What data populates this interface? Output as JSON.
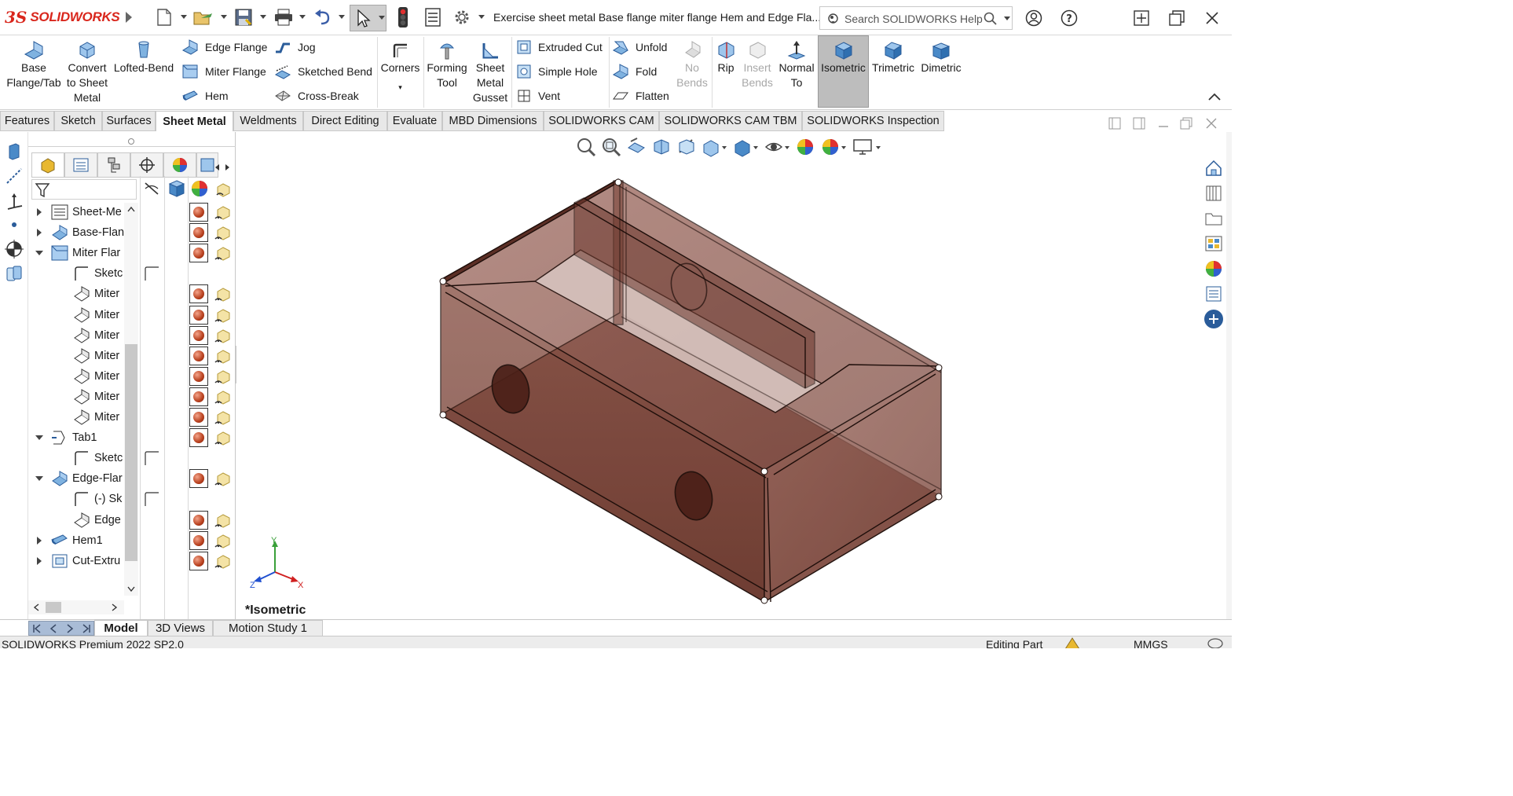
{
  "app": {
    "logo_ds": "3S",
    "logo_text": "SOLIDWORKS",
    "document_title": "Exercise sheet metal Base flange miter flange Hem and Edge Fla...",
    "brand_color": "#d9261c"
  },
  "search": {
    "placeholder": "Search SOLIDWORKS Help"
  },
  "ribbon": {
    "base_flange_l1": "Base",
    "base_flange_l2": "Flange/Tab",
    "convert_l1": "Convert",
    "convert_l2": "to Sheet",
    "convert_l3": "Metal",
    "lofted_bend": "Lofted-Bend",
    "edge_flange": "Edge Flange",
    "miter_flange": "Miter Flange",
    "hem": "Hem",
    "jog": "Jog",
    "sketched_bend": "Sketched Bend",
    "cross_break": "Cross-Break",
    "corners": "Corners",
    "forming_l1": "Forming",
    "forming_l2": "Tool",
    "gusset_l1": "Sheet",
    "gusset_l2": "Metal",
    "gusset_l3": "Gusset",
    "extruded_cut": "Extruded Cut",
    "simple_hole": "Simple Hole",
    "vent": "Vent",
    "unfold": "Unfold",
    "fold": "Fold",
    "flatten": "Flatten",
    "no_bends_l1": "No",
    "no_bends_l2": "Bends",
    "rip": "Rip",
    "insert_bends_l1": "Insert",
    "insert_bends_l2": "Bends",
    "normal_l1": "Normal",
    "normal_l2": "To",
    "isometric": "Isometric",
    "trimetric": "Trimetric",
    "dimetric": "Dimetric"
  },
  "tabs": [
    "Features",
    "Sketch",
    "Surfaces",
    "Sheet Metal",
    "Weldments",
    "Direct Editing",
    "Evaluate",
    "MBD Dimensions",
    "SOLIDWORKS CAM",
    "SOLIDWORKS CAM TBM",
    "SOLIDWORKS Inspection"
  ],
  "active_tab": "Sheet Metal",
  "tree": [
    {
      "label": "Sheet-Me",
      "expand": "collapsed",
      "indent": 0
    },
    {
      "label": "Base-Flan",
      "expand": "collapsed",
      "indent": 0
    },
    {
      "label": "Miter Flar",
      "expand": "expanded",
      "indent": 0
    },
    {
      "label": "Sketc",
      "expand": "none",
      "indent": 1
    },
    {
      "label": "Miter",
      "expand": "none",
      "indent": 1
    },
    {
      "label": "Miter",
      "expand": "none",
      "indent": 1
    },
    {
      "label": "Miter",
      "expand": "none",
      "indent": 1
    },
    {
      "label": "Miter",
      "expand": "none",
      "indent": 1
    },
    {
      "label": "Miter",
      "expand": "none",
      "indent": 1
    },
    {
      "label": "Miter",
      "expand": "none",
      "indent": 1
    },
    {
      "label": "Miter",
      "expand": "none",
      "indent": 1
    },
    {
      "label": "Tab1",
      "expand": "expanded",
      "indent": 0
    },
    {
      "label": "Sketc",
      "expand": "none",
      "indent": 1
    },
    {
      "label": "Edge-Flar",
      "expand": "expanded",
      "indent": 0
    },
    {
      "label": "(-) Sk",
      "expand": "none",
      "indent": 1
    },
    {
      "label": "Edge",
      "expand": "none",
      "indent": 1
    },
    {
      "label": "Hem1",
      "expand": "collapsed",
      "indent": 0
    },
    {
      "label": "Cut-Extru",
      "expand": "collapsed",
      "indent": 0
    }
  ],
  "viewport": {
    "view_label": "*Isometric",
    "axis_x": "X",
    "axis_y": "Y",
    "axis_z": "Z",
    "part_color": "#8a4a3e"
  },
  "bottom_tabs": [
    "Model",
    "3D Views",
    "Motion Study 1"
  ],
  "active_bottom_tab": "Model",
  "status": {
    "product": "SOLIDWORKS Premium 2022 SP2.0",
    "mode": "Editing Part",
    "units": "MMGS"
  }
}
